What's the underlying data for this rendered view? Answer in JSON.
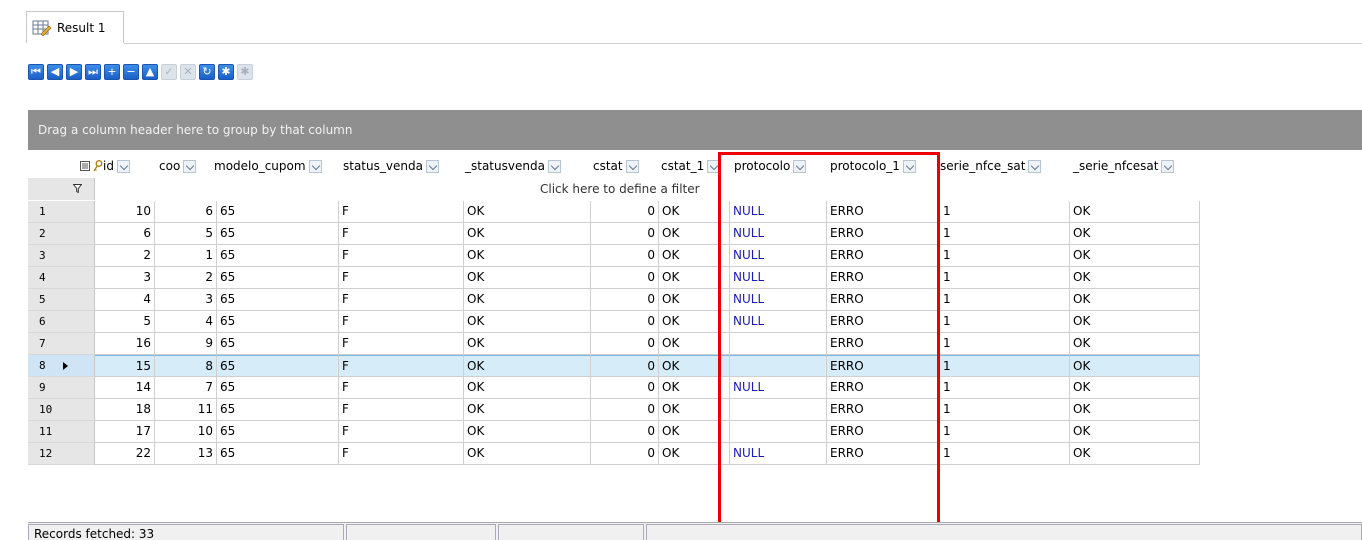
{
  "tab": {
    "label": "Result 1"
  },
  "toolbar": {
    "buttons": [
      {
        "name": "first-record-button",
        "glyph": "⏮",
        "enabled": true
      },
      {
        "name": "prior-record-button",
        "glyph": "◀",
        "enabled": true
      },
      {
        "name": "next-record-button",
        "glyph": "▶",
        "enabled": true
      },
      {
        "name": "last-record-button",
        "glyph": "⏭",
        "enabled": true
      },
      {
        "name": "insert-record-button",
        "glyph": "+",
        "enabled": true
      },
      {
        "name": "delete-record-button",
        "glyph": "−",
        "enabled": true
      },
      {
        "name": "edit-record-button",
        "glyph": "▲",
        "enabled": true
      },
      {
        "name": "post-edit-button",
        "glyph": "✓",
        "enabled": false
      },
      {
        "name": "cancel-edit-button",
        "glyph": "✕",
        "enabled": false
      },
      {
        "name": "refresh-button",
        "glyph": "↻",
        "enabled": true
      },
      {
        "name": "apply-filter-button",
        "glyph": "✱",
        "enabled": true
      },
      {
        "name": "clear-filter-button",
        "glyph": "✱",
        "enabled": false
      }
    ]
  },
  "group_panel": {
    "text": "Drag a column header here to group by that column"
  },
  "grid": {
    "columns": [
      {
        "key": "id",
        "label": "id"
      },
      {
        "key": "coo",
        "label": "coo"
      },
      {
        "key": "modelo_cupom",
        "label": "modelo_cupom"
      },
      {
        "key": "status_venda",
        "label": "status_venda"
      },
      {
        "key": "_statusvenda",
        "label": "_statusvenda"
      },
      {
        "key": "cstat",
        "label": "cstat"
      },
      {
        "key": "cstat_1",
        "label": "cstat_1"
      },
      {
        "key": "protocolo",
        "label": "protocolo"
      },
      {
        "key": "protocolo_1",
        "label": "protocolo_1"
      },
      {
        "key": "serie_nfce_sat",
        "label": "serie_nfce_sat"
      },
      {
        "key": "_serie_nfcesat",
        "label": "_serie_nfcesat"
      }
    ],
    "filter_text": "Click here to define a filter",
    "rows": [
      {
        "n": "1",
        "v": [
          "10",
          "6",
          "65",
          "F",
          "OK",
          "0",
          "OK",
          "NULL",
          "ERRO",
          "1",
          "OK"
        ]
      },
      {
        "n": "2",
        "v": [
          "6",
          "5",
          "65",
          "F",
          "OK",
          "0",
          "OK",
          "NULL",
          "ERRO",
          "1",
          "OK"
        ]
      },
      {
        "n": "3",
        "v": [
          "2",
          "1",
          "65",
          "F",
          "OK",
          "0",
          "OK",
          "NULL",
          "ERRO",
          "1",
          "OK"
        ]
      },
      {
        "n": "4",
        "v": [
          "3",
          "2",
          "65",
          "F",
          "OK",
          "0",
          "OK",
          "NULL",
          "ERRO",
          "1",
          "OK"
        ]
      },
      {
        "n": "5",
        "v": [
          "4",
          "3",
          "65",
          "F",
          "OK",
          "0",
          "OK",
          "NULL",
          "ERRO",
          "1",
          "OK"
        ]
      },
      {
        "n": "6",
        "v": [
          "5",
          "4",
          "65",
          "F",
          "OK",
          "0",
          "OK",
          "NULL",
          "ERRO",
          "1",
          "OK"
        ]
      },
      {
        "n": "7",
        "v": [
          "16",
          "9",
          "65",
          "F",
          "OK",
          "0",
          "OK",
          "",
          "ERRO",
          "1",
          "OK"
        ]
      },
      {
        "n": "8",
        "v": [
          "15",
          "8",
          "65",
          "F",
          "OK",
          "0",
          "OK",
          "",
          "ERRO",
          "1",
          "OK"
        ],
        "selected": true
      },
      {
        "n": "9",
        "v": [
          "14",
          "7",
          "65",
          "F",
          "OK",
          "0",
          "OK",
          "NULL",
          "ERRO",
          "1",
          "OK"
        ]
      },
      {
        "n": "10",
        "v": [
          "18",
          "11",
          "65",
          "F",
          "OK",
          "0",
          "OK",
          "",
          "ERRO",
          "1",
          "OK"
        ]
      },
      {
        "n": "11",
        "v": [
          "17",
          "10",
          "65",
          "F",
          "OK",
          "0",
          "OK",
          "",
          "ERRO",
          "1",
          "OK"
        ]
      },
      {
        "n": "12",
        "v": [
          "22",
          "13",
          "65",
          "F",
          "OK",
          "0",
          "OK",
          "NULL",
          "ERRO",
          "1",
          "OK"
        ]
      }
    ]
  },
  "status": {
    "records": "Records fetched: 33"
  }
}
